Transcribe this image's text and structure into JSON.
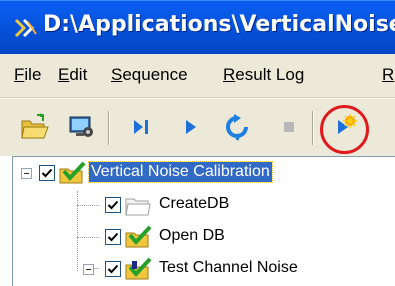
{
  "window": {
    "title": "D:\\Applications\\VerticalNoise",
    "icon": "app-icon"
  },
  "menu": {
    "items": [
      {
        "label": "File"
      },
      {
        "label": "Edit"
      },
      {
        "label": "Sequence"
      },
      {
        "label": "Result Log"
      },
      {
        "label": "R"
      }
    ]
  },
  "toolbar": {
    "buttons": [
      {
        "icon": "open-folder-icon"
      },
      {
        "icon": "monitor-settings-icon"
      },
      {
        "icon": "step-run-icon"
      },
      {
        "icon": "play-icon"
      },
      {
        "icon": "loop-icon"
      },
      {
        "icon": "stop-icon"
      },
      {
        "icon": "run-highlighted-icon"
      }
    ]
  },
  "tree": {
    "nodes": [
      {
        "label": "Vertical Noise Calibration",
        "checked": true,
        "expanded": true,
        "selected": true,
        "icon": "check-folder-icon"
      },
      {
        "label": "CreateDB",
        "checked": true,
        "icon": "empty-folder-icon"
      },
      {
        "label": "Open DB",
        "checked": true,
        "icon": "check-folder-icon"
      },
      {
        "label": "Test Channel Noise",
        "checked": true,
        "expanded": true,
        "icon": "check-folder-icon"
      }
    ]
  },
  "colors": {
    "titlebar": "#0755e0",
    "selection": "#316ac5",
    "highlight_ring": "#e0191c"
  }
}
